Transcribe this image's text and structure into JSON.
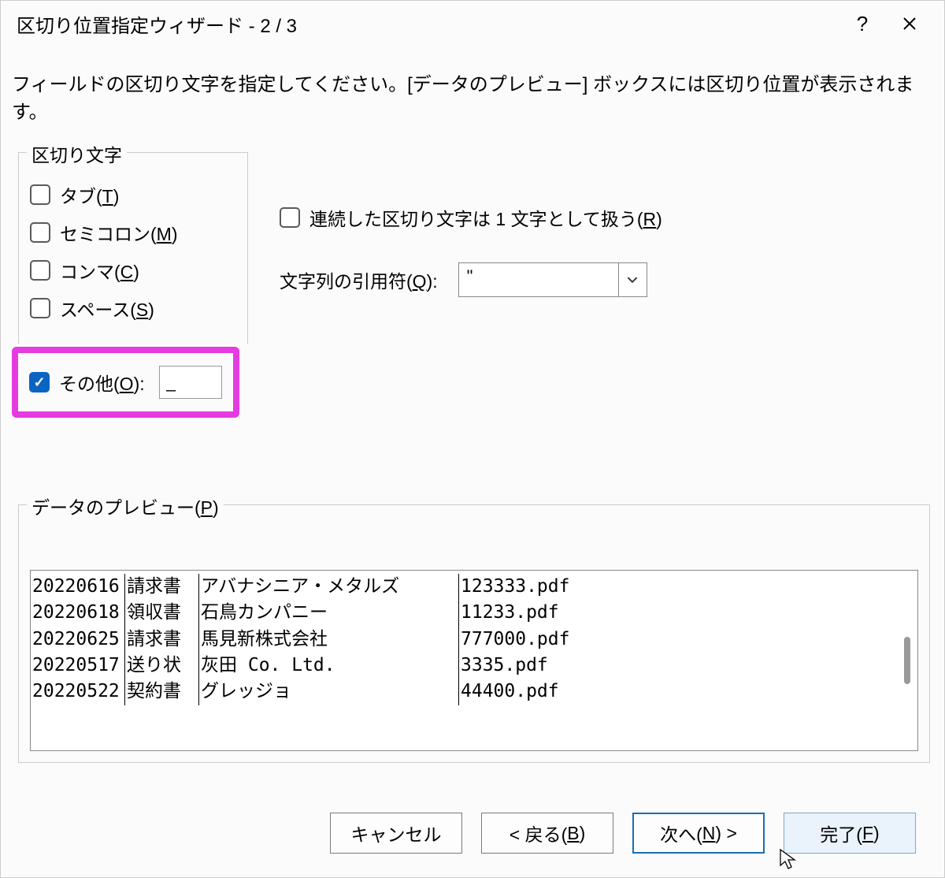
{
  "title": "区切り位置指定ウィザード - 2 / 3",
  "instruction": "フィールドの区切り文字を指定してください。[データのプレビュー] ボックスには区切り位置が表示されます。",
  "delimiters": {
    "group_label": "区切り文字",
    "tab": {
      "label_pre": "タブ(",
      "key": "T",
      "label_post": ")",
      "checked": false
    },
    "semicolon": {
      "label_pre": "セミコロン(",
      "key": "M",
      "label_post": ")",
      "checked": false
    },
    "comma": {
      "label_pre": "コンマ(",
      "key": "C",
      "label_post": ")",
      "checked": false
    },
    "space": {
      "label_pre": "スペース(",
      "key": "S",
      "label_post": ")",
      "checked": false
    },
    "other": {
      "label_pre": "その他(",
      "key": "O",
      "label_post": "):",
      "checked": true,
      "value": "_"
    }
  },
  "consecutive": {
    "label_pre": "連続した区切り文字は 1 文字として扱う(",
    "key": "R",
    "label_post": ")",
    "checked": false
  },
  "qualifier": {
    "label_pre": "文字列の引用符(",
    "key": "Q",
    "label_post": "):",
    "value": "\""
  },
  "preview": {
    "label_pre": "データのプレビュー(",
    "key": "P",
    "label_post": ")",
    "rows": [
      {
        "c0": "20220616",
        "c1": "請求書",
        "c2": "アバナシニア・メタルズ",
        "c3": "123333.pdf"
      },
      {
        "c0": "20220618",
        "c1": "領収書",
        "c2": "石鳥カンパニー",
        "c3": "11233.pdf"
      },
      {
        "c0": "20220625",
        "c1": "請求書",
        "c2": "馬見新株式会社",
        "c3": "777000.pdf"
      },
      {
        "c0": "20220517",
        "c1": "送り状",
        "c2": "灰田 Co. Ltd.",
        "c3": "3335.pdf"
      },
      {
        "c0": "20220522",
        "c1": "契約書",
        "c2": "グレッジョ",
        "c3": "44400.pdf"
      }
    ]
  },
  "buttons": {
    "cancel": "キャンセル",
    "back_pre": "< 戻る(",
    "back_key": "B",
    "back_post": ")",
    "next_pre": "次へ(",
    "next_key": "N",
    "next_post": ") >",
    "finish_pre": "完了(",
    "finish_key": "F",
    "finish_post": ")"
  }
}
